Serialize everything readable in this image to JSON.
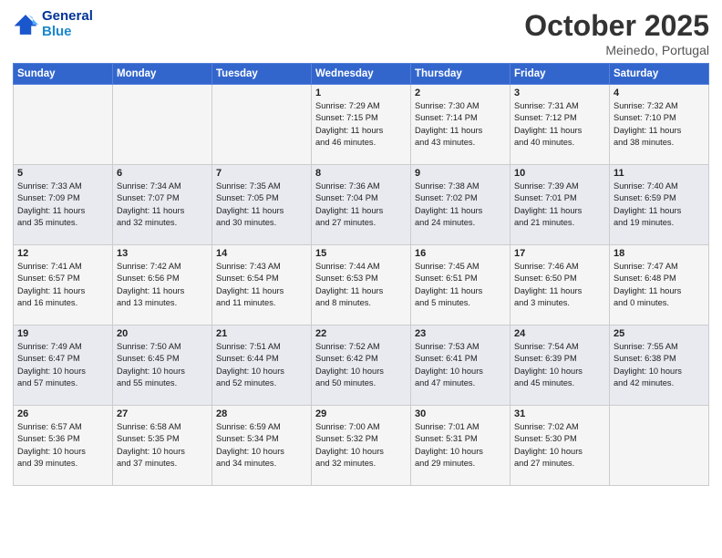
{
  "header": {
    "logo_line1": "General",
    "logo_line2": "Blue",
    "month": "October 2025",
    "location": "Meinedo, Portugal"
  },
  "days_of_week": [
    "Sunday",
    "Monday",
    "Tuesday",
    "Wednesday",
    "Thursday",
    "Friday",
    "Saturday"
  ],
  "weeks": [
    [
      {
        "num": "",
        "info": ""
      },
      {
        "num": "",
        "info": ""
      },
      {
        "num": "",
        "info": ""
      },
      {
        "num": "1",
        "info": "Sunrise: 7:29 AM\nSunset: 7:15 PM\nDaylight: 11 hours\nand 46 minutes."
      },
      {
        "num": "2",
        "info": "Sunrise: 7:30 AM\nSunset: 7:14 PM\nDaylight: 11 hours\nand 43 minutes."
      },
      {
        "num": "3",
        "info": "Sunrise: 7:31 AM\nSunset: 7:12 PM\nDaylight: 11 hours\nand 40 minutes."
      },
      {
        "num": "4",
        "info": "Sunrise: 7:32 AM\nSunset: 7:10 PM\nDaylight: 11 hours\nand 38 minutes."
      }
    ],
    [
      {
        "num": "5",
        "info": "Sunrise: 7:33 AM\nSunset: 7:09 PM\nDaylight: 11 hours\nand 35 minutes."
      },
      {
        "num": "6",
        "info": "Sunrise: 7:34 AM\nSunset: 7:07 PM\nDaylight: 11 hours\nand 32 minutes."
      },
      {
        "num": "7",
        "info": "Sunrise: 7:35 AM\nSunset: 7:05 PM\nDaylight: 11 hours\nand 30 minutes."
      },
      {
        "num": "8",
        "info": "Sunrise: 7:36 AM\nSunset: 7:04 PM\nDaylight: 11 hours\nand 27 minutes."
      },
      {
        "num": "9",
        "info": "Sunrise: 7:38 AM\nSunset: 7:02 PM\nDaylight: 11 hours\nand 24 minutes."
      },
      {
        "num": "10",
        "info": "Sunrise: 7:39 AM\nSunset: 7:01 PM\nDaylight: 11 hours\nand 21 minutes."
      },
      {
        "num": "11",
        "info": "Sunrise: 7:40 AM\nSunset: 6:59 PM\nDaylight: 11 hours\nand 19 minutes."
      }
    ],
    [
      {
        "num": "12",
        "info": "Sunrise: 7:41 AM\nSunset: 6:57 PM\nDaylight: 11 hours\nand 16 minutes."
      },
      {
        "num": "13",
        "info": "Sunrise: 7:42 AM\nSunset: 6:56 PM\nDaylight: 11 hours\nand 13 minutes."
      },
      {
        "num": "14",
        "info": "Sunrise: 7:43 AM\nSunset: 6:54 PM\nDaylight: 11 hours\nand 11 minutes."
      },
      {
        "num": "15",
        "info": "Sunrise: 7:44 AM\nSunset: 6:53 PM\nDaylight: 11 hours\nand 8 minutes."
      },
      {
        "num": "16",
        "info": "Sunrise: 7:45 AM\nSunset: 6:51 PM\nDaylight: 11 hours\nand 5 minutes."
      },
      {
        "num": "17",
        "info": "Sunrise: 7:46 AM\nSunset: 6:50 PM\nDaylight: 11 hours\nand 3 minutes."
      },
      {
        "num": "18",
        "info": "Sunrise: 7:47 AM\nSunset: 6:48 PM\nDaylight: 11 hours\nand 0 minutes."
      }
    ],
    [
      {
        "num": "19",
        "info": "Sunrise: 7:49 AM\nSunset: 6:47 PM\nDaylight: 10 hours\nand 57 minutes."
      },
      {
        "num": "20",
        "info": "Sunrise: 7:50 AM\nSunset: 6:45 PM\nDaylight: 10 hours\nand 55 minutes."
      },
      {
        "num": "21",
        "info": "Sunrise: 7:51 AM\nSunset: 6:44 PM\nDaylight: 10 hours\nand 52 minutes."
      },
      {
        "num": "22",
        "info": "Sunrise: 7:52 AM\nSunset: 6:42 PM\nDaylight: 10 hours\nand 50 minutes."
      },
      {
        "num": "23",
        "info": "Sunrise: 7:53 AM\nSunset: 6:41 PM\nDaylight: 10 hours\nand 47 minutes."
      },
      {
        "num": "24",
        "info": "Sunrise: 7:54 AM\nSunset: 6:39 PM\nDaylight: 10 hours\nand 45 minutes."
      },
      {
        "num": "25",
        "info": "Sunrise: 7:55 AM\nSunset: 6:38 PM\nDaylight: 10 hours\nand 42 minutes."
      }
    ],
    [
      {
        "num": "26",
        "info": "Sunrise: 6:57 AM\nSunset: 5:36 PM\nDaylight: 10 hours\nand 39 minutes."
      },
      {
        "num": "27",
        "info": "Sunrise: 6:58 AM\nSunset: 5:35 PM\nDaylight: 10 hours\nand 37 minutes."
      },
      {
        "num": "28",
        "info": "Sunrise: 6:59 AM\nSunset: 5:34 PM\nDaylight: 10 hours\nand 34 minutes."
      },
      {
        "num": "29",
        "info": "Sunrise: 7:00 AM\nSunset: 5:32 PM\nDaylight: 10 hours\nand 32 minutes."
      },
      {
        "num": "30",
        "info": "Sunrise: 7:01 AM\nSunset: 5:31 PM\nDaylight: 10 hours\nand 29 minutes."
      },
      {
        "num": "31",
        "info": "Sunrise: 7:02 AM\nSunset: 5:30 PM\nDaylight: 10 hours\nand 27 minutes."
      },
      {
        "num": "",
        "info": ""
      }
    ]
  ]
}
